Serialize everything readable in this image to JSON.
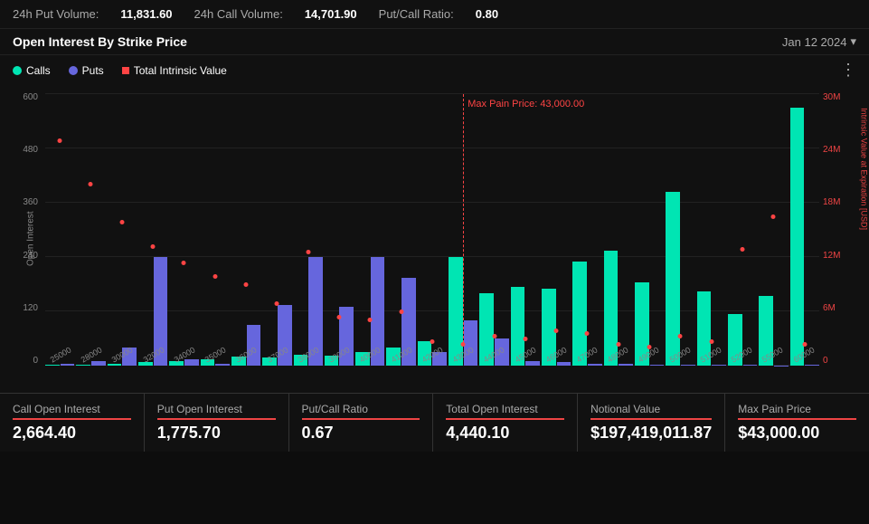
{
  "topBar": {
    "putVolumeLabel": "24h Put Volume:",
    "putVolumeValue": "11,831.60",
    "callVolumeLabel": "24h Call Volume:",
    "callVolumeValue": "14,701.90",
    "ratioLabel": "Put/Call Ratio:",
    "ratioValue": "0.80"
  },
  "header": {
    "title": "Open Interest By Strike Price",
    "date": "Jan 12 2024",
    "chevron": "▾"
  },
  "legend": {
    "calls": "Calls",
    "puts": "Puts",
    "intrinsic": "Total Intrinsic Value",
    "moreIcon": "⋮"
  },
  "chart": {
    "yAxisLeft": [
      "600",
      "480",
      "360",
      "240",
      "120",
      "0"
    ],
    "yAxisRight": [
      "30M",
      "24M",
      "18M",
      "12M",
      "6M",
      "0"
    ],
    "yAxisRightLabel": "Intrinsic Value at Expiration [USD]",
    "openInterestLabel": "Open Interest",
    "maxPainLabel": "Max Pain Price: 43,000.00",
    "maxPainPosition": 0.54,
    "bars": [
      {
        "strike": "25000",
        "call": 2,
        "put": 5,
        "intrinsicPct": 0.82
      },
      {
        "strike": "28000",
        "call": 3,
        "put": 10,
        "intrinsicPct": 0.66
      },
      {
        "strike": "30000",
        "call": 5,
        "put": 40,
        "intrinsicPct": 0.52
      },
      {
        "strike": "32000",
        "call": 8,
        "put": 240,
        "intrinsicPct": 0.43
      },
      {
        "strike": "34000",
        "call": 10,
        "put": 15,
        "intrinsicPct": 0.37
      },
      {
        "strike": "35000",
        "call": 15,
        "put": 5,
        "intrinsicPct": 0.32
      },
      {
        "strike": "36000",
        "call": 20,
        "put": 90,
        "intrinsicPct": 0.29
      },
      {
        "strike": "37000",
        "call": 18,
        "put": 135,
        "intrinsicPct": 0.22
      },
      {
        "strike": "38000",
        "call": 25,
        "put": 240,
        "intrinsicPct": 0.41
      },
      {
        "strike": "39000",
        "call": 22,
        "put": 130,
        "intrinsicPct": 0.17
      },
      {
        "strike": "40000",
        "call": 30,
        "put": 240,
        "intrinsicPct": 0.16
      },
      {
        "strike": "41000",
        "call": 40,
        "put": 195,
        "intrinsicPct": 0.19
      },
      {
        "strike": "42000",
        "call": 55,
        "put": 30,
        "intrinsicPct": 0.08
      },
      {
        "strike": "43000",
        "call": 240,
        "put": 100,
        "intrinsicPct": 0.07
      },
      {
        "strike": "44000",
        "call": 160,
        "put": 60,
        "intrinsicPct": 0.1
      },
      {
        "strike": "45000",
        "call": 175,
        "put": 10,
        "intrinsicPct": 0.09
      },
      {
        "strike": "46000",
        "call": 170,
        "put": 8,
        "intrinsicPct": 0.12
      },
      {
        "strike": "47000",
        "call": 230,
        "put": 5,
        "intrinsicPct": 0.11
      },
      {
        "strike": "48000",
        "call": 255,
        "put": 5,
        "intrinsicPct": 0.07
      },
      {
        "strike": "49000",
        "call": 185,
        "put": 3,
        "intrinsicPct": 0.06
      },
      {
        "strike": "50000",
        "call": 385,
        "put": 3,
        "intrinsicPct": 0.1
      },
      {
        "strike": "51000",
        "call": 165,
        "put": 2,
        "intrinsicPct": 0.08
      },
      {
        "strike": "52000",
        "call": 115,
        "put": 2,
        "intrinsicPct": 0.42
      },
      {
        "strike": "55000",
        "call": 155,
        "put": 1,
        "intrinsicPct": 0.54
      },
      {
        "strike": "60000",
        "call": 570,
        "put": 2,
        "intrinsicPct": 0.07
      }
    ]
  },
  "stats": [
    {
      "label": "Call Open Interest",
      "value": "2,664.40"
    },
    {
      "label": "Put Open Interest",
      "value": "1,775.70"
    },
    {
      "label": "Put/Call Ratio",
      "value": "0.67"
    },
    {
      "label": "Total Open Interest",
      "value": "4,440.10"
    },
    {
      "label": "Notional Value",
      "value": "$197,419,011.87"
    },
    {
      "label": "Max Pain Price",
      "value": "$43,000.00"
    }
  ]
}
